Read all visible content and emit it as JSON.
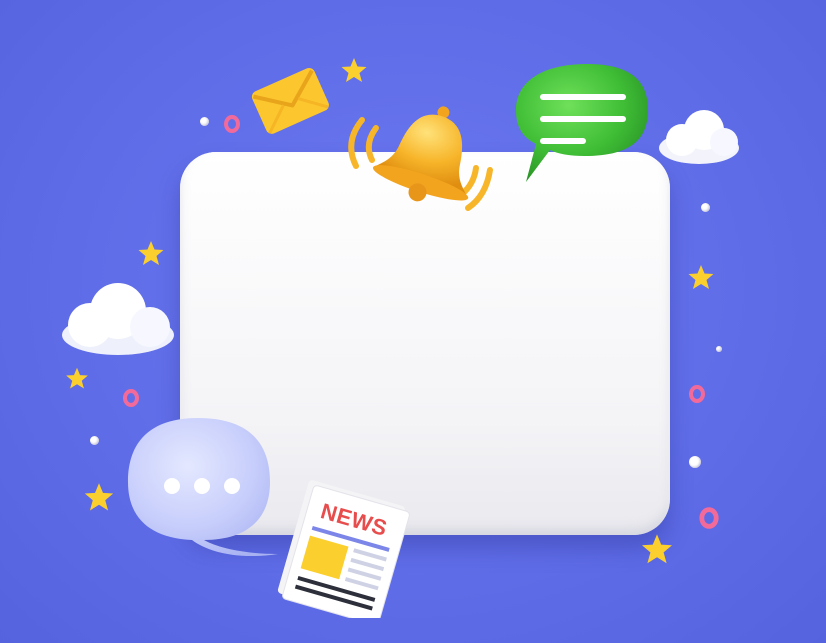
{
  "scene": {
    "newspaper": {
      "headline": "NEWS"
    },
    "blue_bubble": {
      "dots": 3
    },
    "green_bubble": {
      "lines": 3
    },
    "colors": {
      "background": "#5f6de8",
      "board": "#ffffff",
      "green_bubble": "#3fbd35",
      "blue_bubble": "#c6cdfb",
      "bell": "#f7b52a",
      "envelope": "#fcc62f",
      "star": "#fbcf2e",
      "ring": "#f26a9a",
      "news_title": "#e84d4d"
    },
    "icons": [
      "bell-icon",
      "chat-bubble-icon",
      "envelope-icon",
      "newspaper-icon",
      "cloud-icon",
      "star-icon",
      "ring-icon"
    ]
  }
}
